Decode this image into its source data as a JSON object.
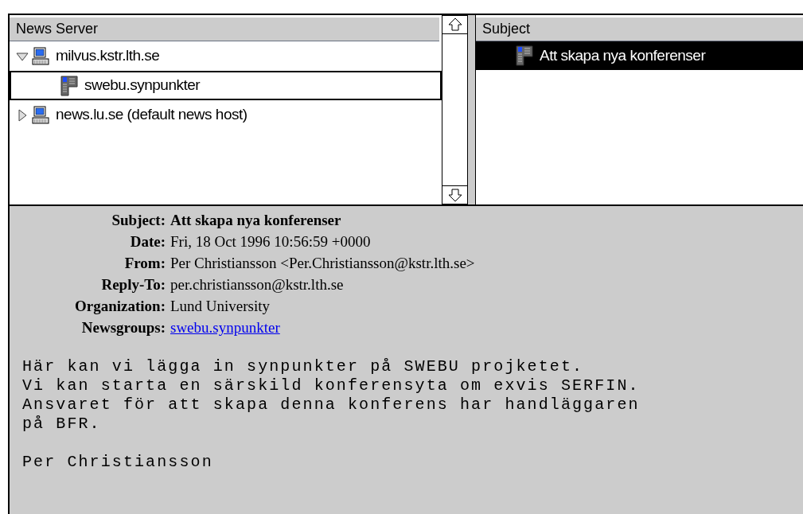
{
  "server_pane": {
    "header": "News Server",
    "tree": [
      {
        "label": "milvus.kstr.lth.se",
        "kind": "server",
        "expanded": true,
        "selected": false,
        "children": [
          {
            "label": "swebu.synpunkter",
            "kind": "group",
            "selected": true
          }
        ]
      },
      {
        "label": "news.lu.se (default news host)",
        "kind": "server",
        "expanded": false,
        "selected": false
      }
    ]
  },
  "subject_pane": {
    "header": "Subject",
    "items": [
      {
        "label": "Att skapa nya konferenser",
        "selected": true
      }
    ]
  },
  "message": {
    "headers": [
      {
        "label": "Subject:",
        "value": "Att skapa nya konferenser",
        "kind": "bold"
      },
      {
        "label": "Date:",
        "value": "Fri, 18 Oct 1996 10:56:59 +0000",
        "kind": "plain"
      },
      {
        "label": "From:",
        "value": "Per Christiansson <Per.Christiansson@kstr.lth.se>",
        "kind": "plain"
      },
      {
        "label": "Reply-To:",
        "value": "per.christiansson@kstr.lth.se",
        "kind": "plain"
      },
      {
        "label": "Organization:",
        "value": "Lund University",
        "kind": "plain"
      },
      {
        "label": "Newsgroups:",
        "value": "swebu.synpunkter",
        "kind": "link"
      }
    ],
    "body": [
      [
        "Här kan vi lägga in synpunkter på SWEBU projketet.",
        "Vi kan starta en särskild konferensyta om exvis SERFIN.",
        "Ansvaret för att skapa denna konferens har handläggaren",
        "på BFR."
      ],
      [
        "Per Christiansson"
      ]
    ]
  }
}
